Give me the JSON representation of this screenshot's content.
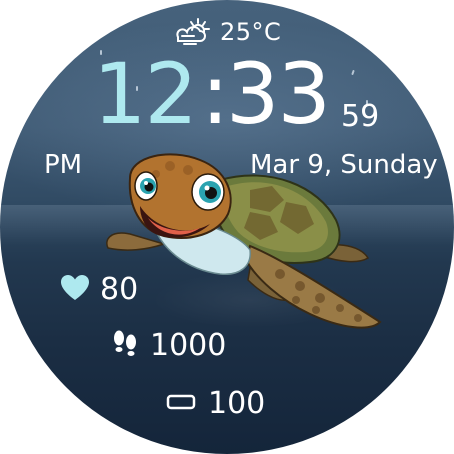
{
  "weather": {
    "icon": "partly-cloudy-sun-icon",
    "temperature": "25°C"
  },
  "time": {
    "hours": "12",
    "separator": ":",
    "minutes": "33",
    "seconds": "59",
    "period": "PM"
  },
  "date": {
    "text": "Mar 9, Sunday"
  },
  "stats": {
    "heart_rate": {
      "icon": "heart-icon",
      "value": "80"
    },
    "steps": {
      "icon": "footprints-icon",
      "value": "1000"
    },
    "battery": {
      "icon": "battery-icon",
      "value": "100"
    }
  },
  "colors": {
    "hours": "#aee9ef",
    "text": "#ffffff",
    "heart_icon": "#aee9ef"
  }
}
